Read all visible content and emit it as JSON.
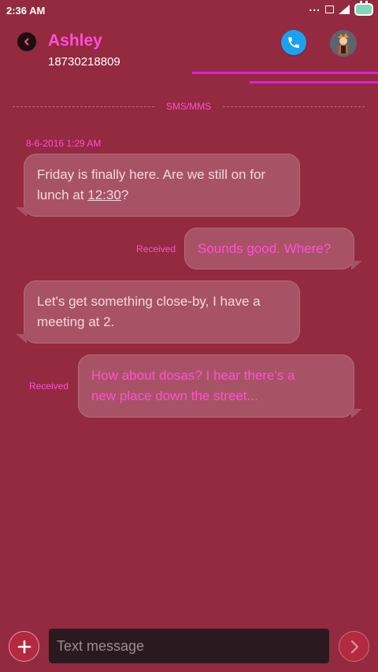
{
  "status_bar": {
    "time": "2:36 AM",
    "dots": "...",
    "battery_color": "#7ed7b9"
  },
  "header": {
    "contact_name": "Ashley",
    "contact_number": "18730218809",
    "back_icon": "chevron-left-icon",
    "call_icon": "phone-icon",
    "accent_color": "#ff4fd8"
  },
  "conversation": {
    "channel_label": "SMS/MMS",
    "timestamp": "8-6-2016 1:29 AM",
    "messages": [
      {
        "direction": "incoming",
        "lines": [
          "Friday is finally here. Are we still on for",
          "lunch at "
        ],
        "link": "12:30",
        "after_link": "?"
      },
      {
        "direction": "outgoing",
        "status": "Received",
        "lines": [
          "Sounds good. Where?"
        ]
      },
      {
        "direction": "incoming",
        "lines": [
          "Let's get something close-by, I have a",
          "meeting at 2."
        ]
      },
      {
        "direction": "outgoing",
        "status": "Received",
        "lines": [
          "How about dosas? I hear there's a",
          "new place down the street..."
        ]
      }
    ]
  },
  "composer": {
    "placeholder": "Text message",
    "add_icon": "plus-icon",
    "send_icon": "chevron-right-icon"
  },
  "colors": {
    "background": "#932a40",
    "bubble": "#a85365",
    "neon": "#e21ce8",
    "call_button": "#1ea0f0"
  }
}
